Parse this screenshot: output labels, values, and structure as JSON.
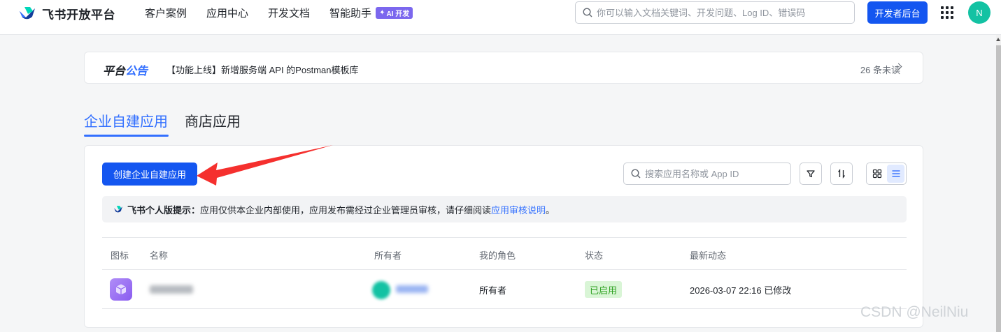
{
  "brand": {
    "name": "飞书开放平台"
  },
  "nav": {
    "items": [
      "客户案例",
      "应用中心",
      "开发文档",
      "智能助手"
    ],
    "ai_badge": "AI 开发"
  },
  "search": {
    "placeholder": "你可以输入文档关键词、开发问题、Log ID、错误码"
  },
  "header": {
    "dev_console_label": "开发者后台",
    "avatar_letter": "N"
  },
  "announcement": {
    "tag_part1": "平台",
    "tag_part2": "公告",
    "text": "【功能上线】新增服务端 API 的Postman模板库",
    "unread": "26 条未读"
  },
  "tabs": [
    {
      "label": "企业自建应用",
      "active": true
    },
    {
      "label": "商店应用",
      "active": false
    }
  ],
  "toolbar": {
    "create_label": "创建企业自建应用",
    "search_placeholder": "搜索应用名称或 App ID"
  },
  "notice": {
    "title": "飞书个人版提示：",
    "body": "应用仅供本企业内部使用，应用发布需经过企业管理员审核，请仔细阅读 ",
    "link": "应用审核说明",
    "end": "。"
  },
  "table": {
    "columns": [
      "图标",
      "名称",
      "所有者",
      "我的角色",
      "状态",
      "最新动态"
    ],
    "rows": [
      {
        "role": "所有者",
        "status": "已启用",
        "latest": "2026-03-07 22:16 已修改"
      }
    ]
  },
  "watermark": "CSDN @NeilNiu",
  "colors": {
    "primary": "#1456f0",
    "accent": "#3370ff",
    "status_green": "#2ea121",
    "annotation_red": "#f5302e"
  }
}
